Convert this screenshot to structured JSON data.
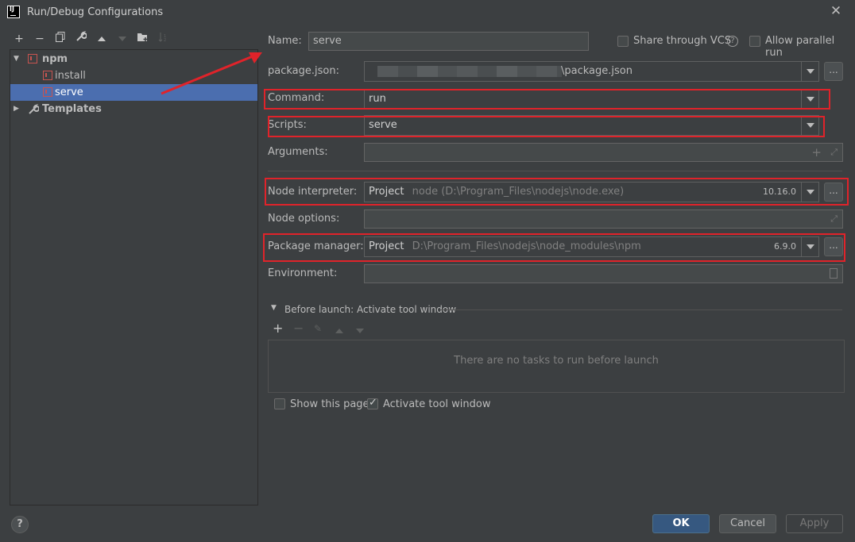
{
  "window": {
    "title": "Run/Debug Configurations",
    "app_icon_text": "IJ"
  },
  "toolbar": {
    "icons": [
      "add-icon",
      "remove-icon",
      "copy-icon",
      "wrench-icon",
      "move-up-icon",
      "move-down-icon",
      "folder-add-icon",
      "sort-icon"
    ]
  },
  "tree": {
    "npm_label": "npm",
    "install_label": "install",
    "serve_label": "serve",
    "templates_label": "Templates"
  },
  "form": {
    "name_label": "Name:",
    "name_value": "serve",
    "share_vcs_label": "Share through VCS",
    "allow_parallel_label": "Allow parallel run",
    "package_json_label": "package.json:",
    "package_json_value": "\\package.json",
    "command_label": "Command:",
    "command_value": "run",
    "scripts_label": "Scripts:",
    "scripts_value": "serve",
    "arguments_label": "Arguments:",
    "node_interpreter_label": "Node interpreter:",
    "node_interpreter_project": "Project",
    "node_interpreter_path": "node (D:\\Program_Files\\nodejs\\node.exe)",
    "node_interpreter_version": "10.16.0",
    "node_options_label": "Node options:",
    "package_manager_label": "Package manager:",
    "package_manager_project": "Project",
    "package_manager_path": "D:\\Program_Files\\nodejs\\node_modules\\npm",
    "package_manager_version": "6.9.0",
    "environment_label": "Environment:",
    "ellipsis": "..."
  },
  "before_launch": {
    "header": "Before launch: Activate tool window",
    "empty_text": "There are no tasks to run before launch",
    "show_this_page_label": "Show this page",
    "activate_tool_window_label": "Activate tool window"
  },
  "buttons": {
    "ok": "OK",
    "cancel": "Cancel",
    "apply": "Apply",
    "help": "?"
  },
  "colors": {
    "highlight_red": "#e0232a",
    "selection_blue": "#4b6eaf",
    "ok_blue": "#365880"
  }
}
